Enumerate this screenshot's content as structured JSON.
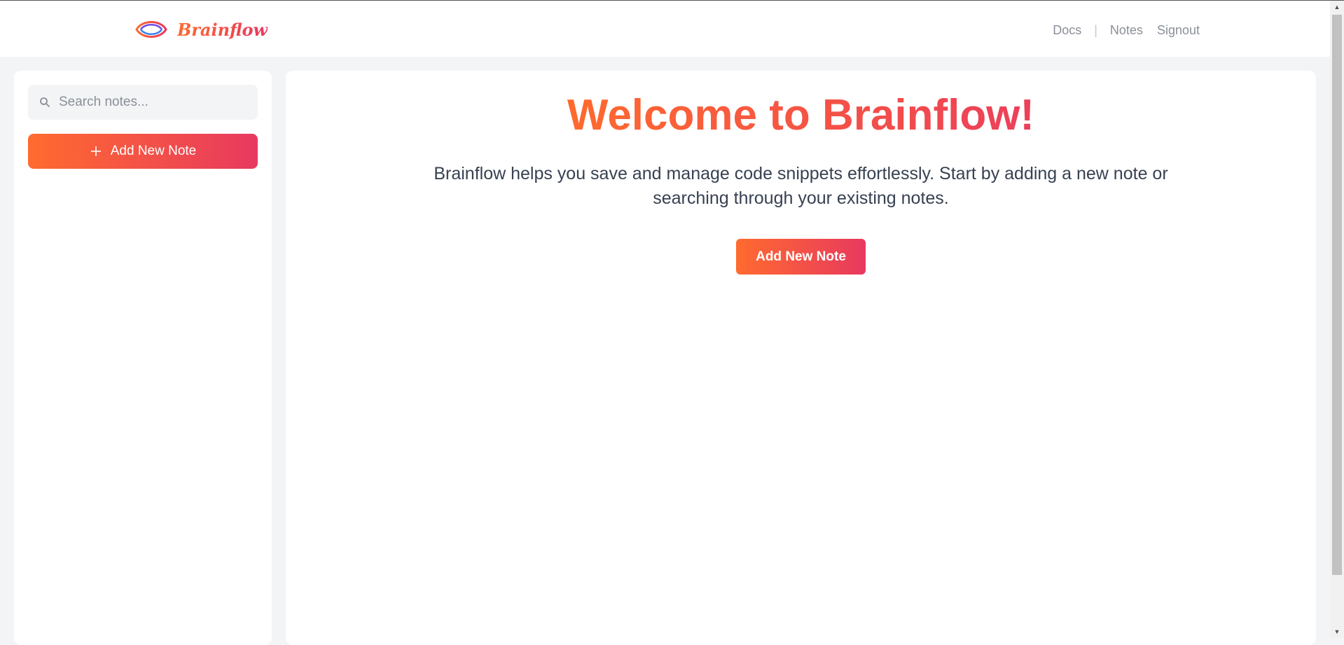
{
  "brand": {
    "name": "Brainflow"
  },
  "nav": {
    "docs": "Docs",
    "separator": "|",
    "notes": "Notes",
    "signout": "Signout"
  },
  "sidebar": {
    "search_placeholder": "Search notes...",
    "add_button_label": "Add New Note"
  },
  "main": {
    "title": "Welcome to Brainflow!",
    "description": "Brainflow helps you save and manage code snippets effortlessly. Start by adding a new note or searching through your existing notes.",
    "add_button_label": "Add New Note"
  },
  "icons": {
    "logo": "brainflow-eye-logo",
    "search": "search-icon",
    "plus": "plus-icon"
  },
  "colors": {
    "accent_start": "#ff6b2f",
    "accent_end": "#e8395f",
    "page_bg": "#f3f4f6",
    "nav_text": "#8a8f98"
  }
}
